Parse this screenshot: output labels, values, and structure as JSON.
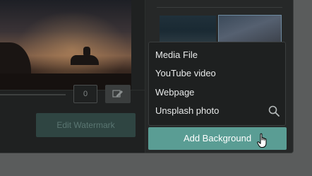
{
  "watermark": {
    "value_field": "0",
    "tool_icon": "pen-icon",
    "edit_label": "Edit Watermark"
  },
  "background_menu": {
    "items": [
      {
        "label": "Media File"
      },
      {
        "label": "YouTube video"
      },
      {
        "label": "Webpage"
      },
      {
        "label": "Unsplash photo",
        "icon": "search-icon"
      }
    ]
  },
  "add_background": {
    "label": "Add Background"
  },
  "colors": {
    "accent": "#5a9d94",
    "panel_bg": "#1f2121",
    "menu_bg": "#1e2020"
  }
}
